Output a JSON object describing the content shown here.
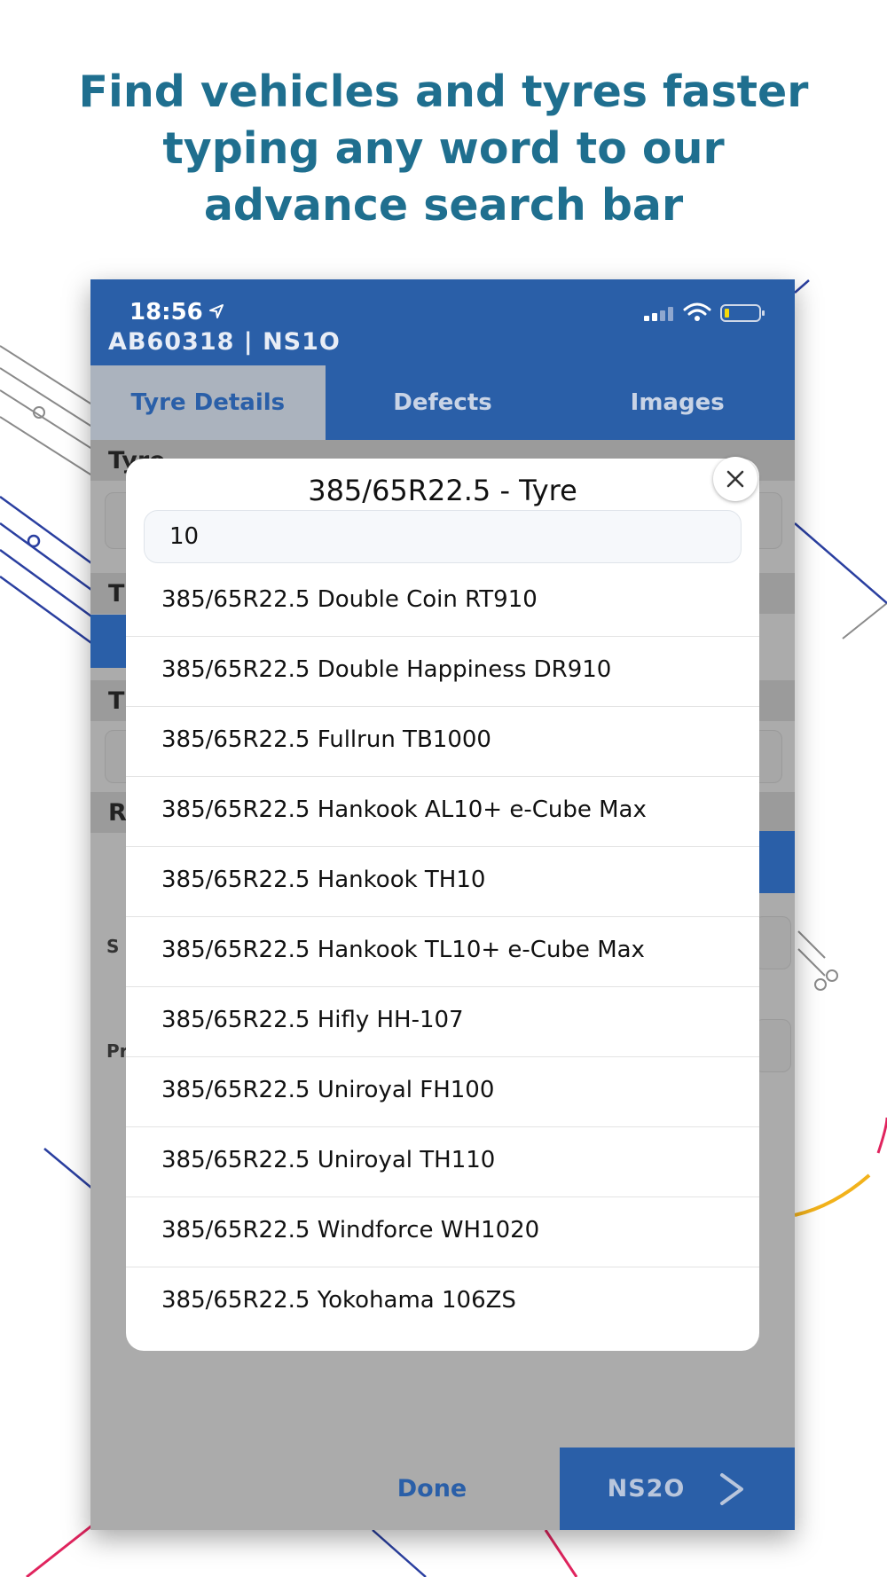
{
  "headline": {
    "line1": "Find vehicles and tyres faster",
    "line2": "typing any word to our",
    "line3": "advance search bar"
  },
  "status_bar": {
    "time": "18:56"
  },
  "header": {
    "vehicle_id": "AB60318 | NS1O"
  },
  "tabs": [
    {
      "label": "Tyre Details",
      "active": true
    },
    {
      "label": "Defects",
      "active": false
    },
    {
      "label": "Images",
      "active": false
    }
  ],
  "background_form": {
    "sections": [
      {
        "label": "Tyre"
      },
      {
        "label": "T"
      },
      {
        "label": "T"
      },
      {
        "label": "R"
      }
    ],
    "row_labels": [
      "S",
      "Pr"
    ]
  },
  "modal": {
    "title": "385/65R22.5 - Tyre",
    "search_value": "10",
    "items": [
      "385/65R22.5 Double Coin RT910",
      "385/65R22.5 Double Happiness DR910",
      "385/65R22.5 Fullrun TB1000",
      "385/65R22.5 Hankook AL10+ e-Cube Max",
      "385/65R22.5 Hankook TH10",
      "385/65R22.5 Hankook TL10+ e-Cube Max",
      "385/65R22.5 Hifly HH-107",
      "385/65R22.5 Uniroyal FH100",
      "385/65R22.5 Uniroyal TH110",
      "385/65R22.5 Windforce WH1020",
      "385/65R22.5 Yokohama 106ZS"
    ]
  },
  "footer": {
    "done_label": "Done",
    "next_label": "NS2O"
  },
  "colors": {
    "brand_blue": "#2a5fa8",
    "headline_teal": "#1f6f8f",
    "overlay_gray": "#ababab"
  }
}
